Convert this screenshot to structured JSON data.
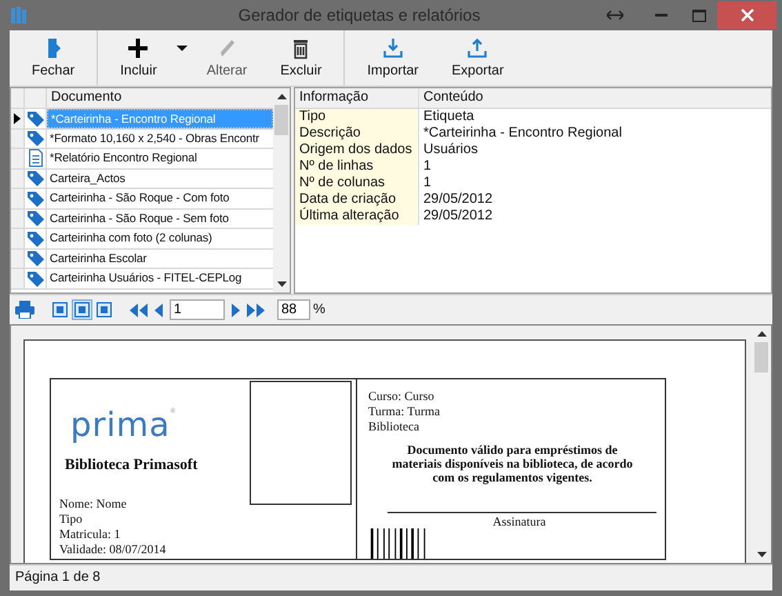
{
  "window": {
    "title": "Gerador de etiquetas e relatórios"
  },
  "toolbar": {
    "groups": [
      [
        {
          "label": "Fechar",
          "kind": "close",
          "disabled": false
        }
      ],
      [
        {
          "label": "Incluir",
          "kind": "add",
          "disabled": false,
          "dropdown": true
        },
        {
          "label": "Alterar",
          "kind": "edit",
          "disabled": true
        },
        {
          "label": "Excluir",
          "kind": "delete",
          "disabled": false
        }
      ],
      [
        {
          "label": "Importar",
          "kind": "import",
          "disabled": false
        },
        {
          "label": "Exportar",
          "kind": "export",
          "disabled": false
        }
      ]
    ]
  },
  "documents": {
    "column": "Documento",
    "rows": [
      {
        "text": "*Carteirinha - Encontro Regional",
        "kind": "label",
        "selected": true
      },
      {
        "text": "*Formato 10,160 x 2,540 - Obras Encontr",
        "kind": "label",
        "selected": false
      },
      {
        "text": "*Relatório Encontro Regional",
        "kind": "report",
        "selected": false
      },
      {
        "text": "Carteira_Actos",
        "kind": "label",
        "selected": false
      },
      {
        "text": "Carteirinha - São Roque - Com foto",
        "kind": "label",
        "selected": false
      },
      {
        "text": "Carteirinha - São Roque - Sem foto",
        "kind": "label",
        "selected": false
      },
      {
        "text": "Carteirinha com foto (2 colunas)",
        "kind": "label",
        "selected": false
      },
      {
        "text": "Carteirinha Escolar",
        "kind": "label",
        "selected": false
      },
      {
        "text": "Carteirinha Usuários - FITEL-CEPLog",
        "kind": "label",
        "selected": false
      }
    ]
  },
  "details": {
    "columns": [
      "Informação",
      "Conteúdo"
    ],
    "rows": [
      [
        "Tipo",
        "Etiqueta"
      ],
      [
        "Descrição",
        "*Carteirinha - Encontro Regional"
      ],
      [
        "Origem dos dados",
        "Usuários"
      ],
      [
        "Nº de linhas",
        "1"
      ],
      [
        "Nº de colunas",
        "1"
      ],
      [
        "Data de criação",
        "29/05/2012"
      ],
      [
        "Última alteração",
        "29/05/2012"
      ]
    ]
  },
  "preview_toolbar": {
    "view_modes": [
      {
        "selected": false
      },
      {
        "selected": true
      },
      {
        "selected": false
      }
    ],
    "page": "1",
    "zoom": "88",
    "zoom_unit": "%"
  },
  "card": {
    "logo": "prima",
    "logo_mark": "®",
    "library": "Biblioteca Primasoft",
    "left_lines": [
      "Nome: Nome",
      "Tipo",
      "Matricula: 1",
      "Validade: 08/07/2014"
    ],
    "right_lines": [
      "Curso: Curso",
      "Turma: Turma",
      "Biblioteca"
    ],
    "notice": "Documento válido para empréstimos de materiais disponíveis na biblioteca, de acordo com os regulamentos vigentes.",
    "signature": "Assinatura"
  },
  "status_bar": "Página 1 de 8"
}
